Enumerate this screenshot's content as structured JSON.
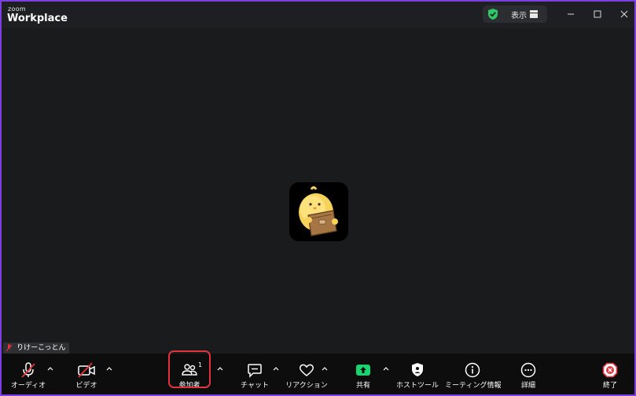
{
  "titlebar": {
    "logo_small": "zoom",
    "logo_big": "Workplace",
    "view_label": "表示"
  },
  "participant": {
    "name": "りけーこっとん"
  },
  "toolbar": {
    "audio_label": "オーディオ",
    "video_label": "ビデオ",
    "participants_label": "参加者",
    "participants_count": "1",
    "chat_label": "チャット",
    "reaction_label": "リアクション",
    "share_label": "共有",
    "host_tools_label": "ホストツール",
    "meeting_info_label": "ミーティング情報",
    "more_label": "詳細",
    "end_label": "終了"
  },
  "colors": {
    "frame": "#7b3fe4",
    "share_green": "#19d36e",
    "end_red": "#e0333c",
    "muted_red": "#e0333c",
    "shield_green": "#2ec866"
  }
}
